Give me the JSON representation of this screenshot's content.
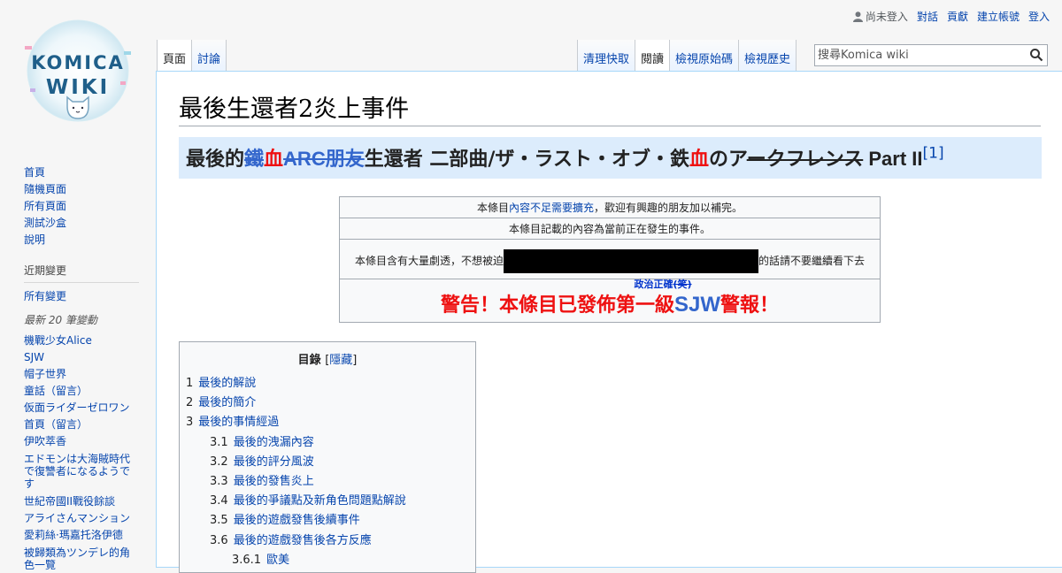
{
  "personal": {
    "anon": "尚未登入",
    "links": [
      "對話",
      "貢獻",
      "建立帳號",
      "登入"
    ]
  },
  "logo": {
    "line1": "KOMICA",
    "line2": "WIKI"
  },
  "sidebar": {
    "nav": [
      "首頁",
      "隨機頁面",
      "所有頁面",
      "測試沙盒",
      "說明"
    ],
    "recent_heading": "近期變更",
    "recent_all": "所有變更",
    "recent_sub": "最新 20 筆變動",
    "recent_items": [
      "機戰少女Alice",
      "SJW",
      "帽子世界",
      "童話（留言）",
      "仮面ライダーゼロワン",
      "首頁（留言）",
      "伊吹萃香",
      "エドモンは大海賊時代で復讐者になるようです",
      "世紀帝國II戰役餘談",
      "アライさんマンション",
      "愛莉絲·瑪嘉托洛伊德",
      "被歸類為ツンデレ的角色一覽"
    ]
  },
  "tabs": {
    "left": [
      "頁面",
      "討論"
    ],
    "right": [
      "清理快取",
      "閱讀",
      "檢視原始碼",
      "檢視歷史"
    ]
  },
  "search": {
    "placeholder": "搜尋Komica wiki"
  },
  "page": {
    "title": "最後生還者2炎上事件",
    "banner": {
      "p1": "最後的",
      "p2": "鐵",
      "p3": "血",
      "p4": "ARC朋友",
      "p5": "生還者 二部曲/ザ・ラスト・オブ・鉄",
      "p6": "血",
      "p7": "のア",
      "p8": "ークフレンス",
      "p9": " Part II",
      "ref": "[1]"
    },
    "notice": {
      "row1_pre": "本條目",
      "row1_link": "內容不足需要擴充",
      "row1_post": "，歡迎有興趣的朋友加以補完。",
      "row2": "本條目記載的內容為當前正在發生的事件。",
      "row3_pre": "本條目含有大量劇透，不想被迫",
      "row3_post": "的話請不要繼續看下去",
      "small_link": "政治正確",
      "small_laugh": "(笑)",
      "warn_pre": "警告！本條目已發佈第一級",
      "warn_sjw": "SJW",
      "warn_post": "警報！"
    },
    "toc": {
      "title": "目錄",
      "toggle_open": "[",
      "toggle": "隱藏",
      "toggle_close": "]",
      "items": [
        {
          "num": "1",
          "text": "最後的解說",
          "level": 1
        },
        {
          "num": "2",
          "text": "最後的簡介",
          "level": 1
        },
        {
          "num": "3",
          "text": "最後的事情經過",
          "level": 1
        },
        {
          "num": "3.1",
          "text": "最後的洩漏內容",
          "level": 2
        },
        {
          "num": "3.2",
          "text": "最後的評分風波",
          "level": 2
        },
        {
          "num": "3.3",
          "text": "最後的發售炎上",
          "level": 2
        },
        {
          "num": "3.4",
          "text": "最後的爭議點及新角色問題點解說",
          "level": 2
        },
        {
          "num": "3.5",
          "text": "最後的遊戲發售後續事件",
          "level": 2
        },
        {
          "num": "3.6",
          "text": "最後的遊戲發售後各方反應",
          "level": 2
        },
        {
          "num": "3.6.1",
          "text": "歐美",
          "level": 3
        }
      ]
    }
  }
}
